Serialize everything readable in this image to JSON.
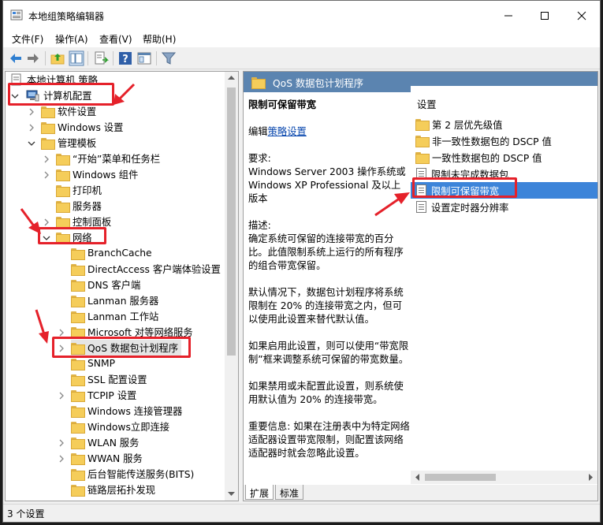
{
  "window": {
    "title": "本地组策略编辑器"
  },
  "menu": [
    {
      "label": "文件(F)"
    },
    {
      "label": "操作(A)"
    },
    {
      "label": "查看(V)"
    },
    {
      "label": "帮助(H)"
    }
  ],
  "toolbar_icons": [
    "back-icon",
    "forward-icon",
    "up-folder-icon",
    "show-hide-tree-icon",
    "export-list-icon",
    "help-icon",
    "properties-icon",
    "filter-icon"
  ],
  "tree": {
    "root": "本地计算机 策略",
    "computer_config": "计算机配置",
    "software_settings": "软件设置",
    "windows_settings": "Windows 设置",
    "admin_templates": "管理模板",
    "start_menu": "“开始”菜单和任务栏",
    "windows_components": "Windows 组件",
    "printers": "打印机",
    "server": "服务器",
    "control_panel": "控制面板",
    "network": "网络",
    "network_children": [
      "BranchCache",
      "DirectAccess 客户端体验设置",
      "DNS 客户端",
      "Lanman 服务器",
      "Lanman 工作站",
      "Microsoft 对等网络服务",
      "QoS 数据包计划程序",
      "SNMP",
      "SSL 配置设置",
      "TCPIP 设置",
      "Windows 连接管理器",
      "Windows立即连接",
      "WLAN 服务",
      "WWAN 服务",
      "后台智能传送服务(BITS)",
      "链路层拓扑发现"
    ]
  },
  "right": {
    "header": "QoS 数据包计划程序",
    "desc_title": "限制可保留带宽",
    "edit_prefix": "编辑",
    "edit_link": "策略设置",
    "requirement_label": "要求:",
    "requirement_text": "Windows Server 2003 操作系统或 Windows XP Professional 及以上版本",
    "description_label": "描述:",
    "description_text": "确定系统可保留的连接带宽的百分比。此值限制系统上运行的所有程序的组合带宽保留。",
    "default_text": "默认情况下，数据包计划程序将系统限制在 20% 的连接带宽之内，但可以使用此设置来替代默认值。",
    "enabled_text": "如果启用此设置，则可以使用“带宽限制”框来调整系统可保留的带宽数量。",
    "disabled_text": "如果禁用或未配置此设置，则系统使用默认值为 20% 的连接带宽。",
    "important_text": "重要信息: 如果在注册表中为特定网络适配器设置带宽限制，则配置该网络适配器时就会忽略此设置。",
    "settings_header": "设置",
    "settings": [
      {
        "label": "第 2 层优先级值",
        "kind": "folder"
      },
      {
        "label": "非一致性数据包的 DSCP 值",
        "kind": "folder"
      },
      {
        "label": "一致性数据包的 DSCP 值",
        "kind": "folder"
      },
      {
        "label": "限制未完成数据包",
        "kind": "policy"
      },
      {
        "label": "限制可保留带宽",
        "kind": "policy"
      },
      {
        "label": "设置定时器分辨率",
        "kind": "policy"
      }
    ],
    "tabs": [
      "扩展",
      "标准"
    ]
  },
  "status": {
    "text": "3 个设置"
  },
  "colors": {
    "highlight": "#3c84d9",
    "header": "#5b84b0",
    "annotation": "#e5212a"
  }
}
